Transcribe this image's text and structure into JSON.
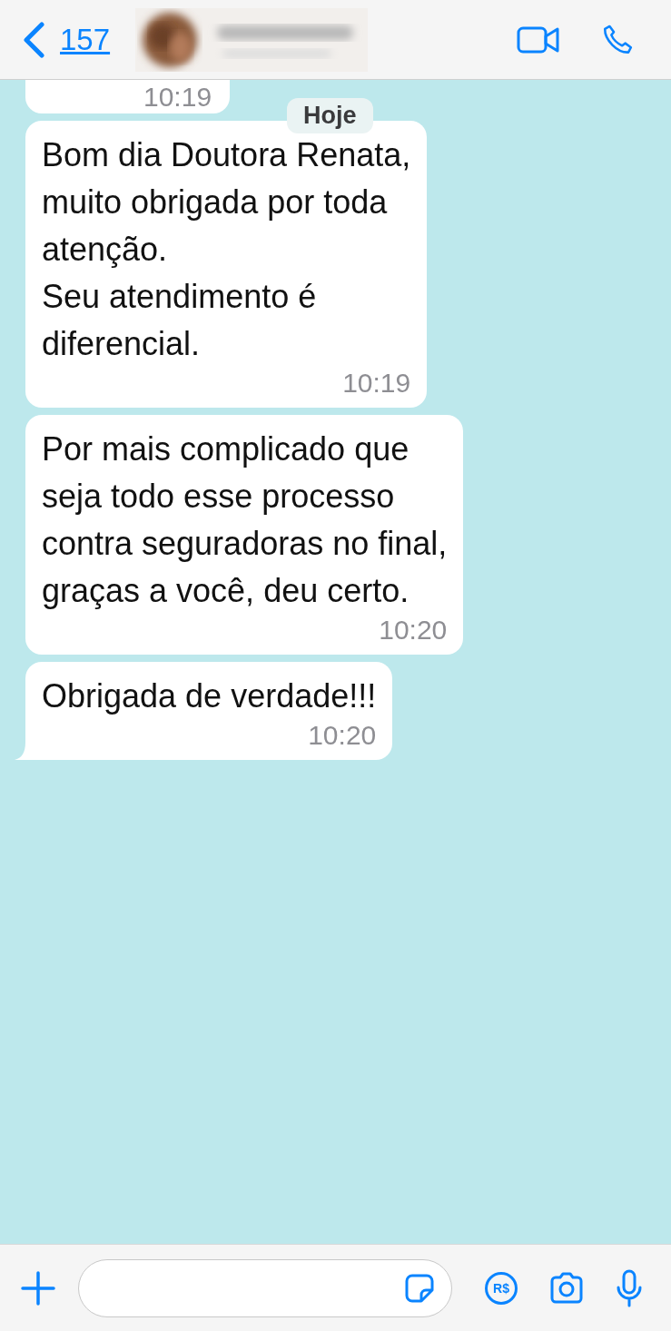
{
  "header": {
    "back_count": "157"
  },
  "date_chip": "Hoje",
  "messages": [
    {
      "kind": "cut",
      "time": "10:19"
    },
    {
      "kind": "full",
      "text": "Bom dia Doutora Renata,\nmuito obrigada por toda\natenção.\nSeu atendimento é\ndiferencial.",
      "time": "10:19",
      "tail": false
    },
    {
      "kind": "full",
      "text": "Por mais complicado que\nseja todo esse processo\ncontra seguradoras no final,\ngraças a você, deu certo.",
      "time": "10:20",
      "tail": false
    },
    {
      "kind": "full",
      "text": "Obrigada de verdade!!!",
      "time": "10:20",
      "tail": true
    }
  ],
  "composer": {
    "pay_label": "R$"
  }
}
